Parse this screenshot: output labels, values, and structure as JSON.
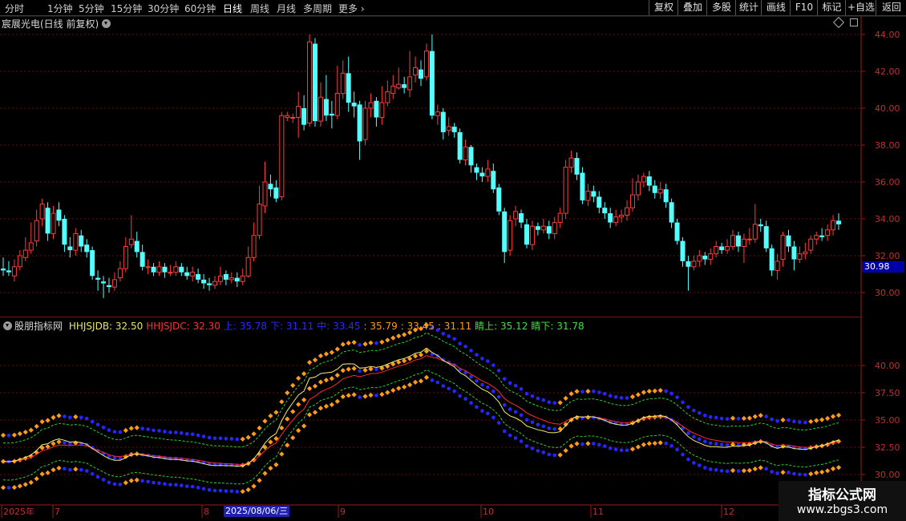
{
  "toolbar": {
    "periods": [
      "分时",
      "1分钟",
      "5分钟",
      "15分钟",
      "30分钟",
      "60分钟",
      "日线",
      "周线",
      "月线",
      "多周期",
      "更多"
    ],
    "active_period": "日线",
    "right_buttons": [
      "复权",
      "叠加",
      "多股",
      "统计",
      "画线",
      "F10",
      "标记",
      "+自选",
      "返回"
    ]
  },
  "main_chart": {
    "title": "宸展光电(日线 前复权)",
    "current_price": "30.98",
    "y_ticks": [
      "44.00",
      "42.00",
      "40.00",
      "38.00",
      "36.00",
      "34.00",
      "32.00",
      "30.00"
    ],
    "candles": [
      [
        31.3,
        31.2,
        31.9,
        30.9
      ],
      [
        31.2,
        31.1,
        31.7,
        30.9
      ],
      [
        30.9,
        31.4,
        31.8,
        30.6
      ],
      [
        31.4,
        32.0,
        32.3,
        31.2
      ],
      [
        31.9,
        32.3,
        33.0,
        31.7
      ],
      [
        32.3,
        32.7,
        33.8,
        32.1
      ],
      [
        32.8,
        33.9,
        34.5,
        32.5
      ],
      [
        34.0,
        34.8,
        35.1,
        33.6
      ],
      [
        34.6,
        33.2,
        34.9,
        32.8
      ],
      [
        33.2,
        34.3,
        34.7,
        32.9
      ],
      [
        34.5,
        33.9,
        34.9,
        33.6
      ],
      [
        34.0,
        32.6,
        34.2,
        32.2
      ],
      [
        32.5,
        32.3,
        33.0,
        31.9
      ],
      [
        32.3,
        33.2,
        33.5,
        32.0
      ],
      [
        33.1,
        32.5,
        33.4,
        32.2
      ],
      [
        32.6,
        32.2,
        32.9,
        31.9
      ],
      [
        32.3,
        30.9,
        32.5,
        30.7
      ],
      [
        30.8,
        30.7,
        31.2,
        30.1
      ],
      [
        30.6,
        30.5,
        30.9,
        29.7
      ],
      [
        30.4,
        30.3,
        30.8,
        30.0
      ],
      [
        30.3,
        30.7,
        31.1,
        30.1
      ],
      [
        30.8,
        31.3,
        31.7,
        30.6
      ],
      [
        31.3,
        32.5,
        33.0,
        31.1
      ],
      [
        32.6,
        32.9,
        34.2,
        32.4
      ],
      [
        32.8,
        32.2,
        33.3,
        31.9
      ],
      [
        32.2,
        31.4,
        32.6,
        31.2
      ],
      [
        31.4,
        31.4,
        31.8,
        31.0
      ],
      [
        31.4,
        31.1,
        31.6,
        30.9
      ],
      [
        31.1,
        31.4,
        31.7,
        30.9
      ],
      [
        31.4,
        31.1,
        31.6,
        30.8
      ],
      [
        31.1,
        31.1,
        31.5,
        30.9
      ],
      [
        31.1,
        31.4,
        31.7,
        30.9
      ],
      [
        31.4,
        31.1,
        31.6,
        30.9
      ],
      [
        31.1,
        30.9,
        31.4,
        30.7
      ],
      [
        30.9,
        31.1,
        31.4,
        30.6
      ],
      [
        31.0,
        30.7,
        31.3,
        30.5
      ],
      [
        30.7,
        30.5,
        31.0,
        30.2
      ],
      [
        30.5,
        30.4,
        30.8,
        30.1
      ],
      [
        30.4,
        30.6,
        30.9,
        30.2
      ],
      [
        30.6,
        30.9,
        31.4,
        30.4
      ],
      [
        31.0,
        30.7,
        31.2,
        30.4
      ],
      [
        30.7,
        30.8,
        31.1,
        30.5
      ],
      [
        30.8,
        30.6,
        31.1,
        30.3
      ],
      [
        30.6,
        30.9,
        31.3,
        30.4
      ],
      [
        30.9,
        31.9,
        32.5,
        30.8
      ],
      [
        31.9,
        33.1,
        33.8,
        31.7
      ],
      [
        33.1,
        34.8,
        35.8,
        32.9
      ],
      [
        34.7,
        36.0,
        37.1,
        34.3
      ],
      [
        35.9,
        35.6,
        36.4,
        35.2
      ],
      [
        35.7,
        35.1,
        36.1,
        34.9
      ],
      [
        35.2,
        39.6,
        39.8,
        35.0
      ],
      [
        39.5,
        39.6,
        39.8,
        39.3
      ],
      [
        39.5,
        39.5,
        39.7,
        39.2
      ],
      [
        39.5,
        40.1,
        40.9,
        38.4
      ],
      [
        40.0,
        39.1,
        40.7,
        38.8
      ],
      [
        39.2,
        43.6,
        44.0,
        39.0
      ],
      [
        43.5,
        39.3,
        43.8,
        39.0
      ],
      [
        39.3,
        40.6,
        41.4,
        39.0
      ],
      [
        40.5,
        39.6,
        41.8,
        39.3
      ],
      [
        39.7,
        39.6,
        40.4,
        38.9
      ],
      [
        39.6,
        40.8,
        42.3,
        39.4
      ],
      [
        40.8,
        41.9,
        42.6,
        40.5
      ],
      [
        41.9,
        40.3,
        42.8,
        39.8
      ],
      [
        40.3,
        40.1,
        40.9,
        39.5
      ],
      [
        40.2,
        38.2,
        40.4,
        37.2
      ],
      [
        38.3,
        40.0,
        40.4,
        38.0
      ],
      [
        40.0,
        40.3,
        40.8,
        39.5
      ],
      [
        40.4,
        39.5,
        40.6,
        39.0
      ],
      [
        39.5,
        40.3,
        41.2,
        39.1
      ],
      [
        40.3,
        40.9,
        41.5,
        40.1
      ],
      [
        40.8,
        41.2,
        41.8,
        40.5
      ],
      [
        41.1,
        41.3,
        42.2,
        41.0
      ],
      [
        41.3,
        41.1,
        41.7,
        40.8
      ],
      [
        41.0,
        41.7,
        43.1,
        40.6
      ],
      [
        41.8,
        42.2,
        42.8,
        41.4
      ],
      [
        42.1,
        41.6,
        42.6,
        41.2
      ],
      [
        41.7,
        43.1,
        43.5,
        41.5
      ],
      [
        43.1,
        39.6,
        44.0,
        39.4
      ],
      [
        39.6,
        39.8,
        40.2,
        39.1
      ],
      [
        39.8,
        38.7,
        40.0,
        38.3
      ],
      [
        38.8,
        39.0,
        39.5,
        38.5
      ],
      [
        39.0,
        38.7,
        39.2,
        38.4
      ],
      [
        38.7,
        37.2,
        38.9,
        37.0
      ],
      [
        37.2,
        37.9,
        38.3,
        36.9
      ],
      [
        37.9,
        36.9,
        38.0,
        36.5
      ],
      [
        36.8,
        36.5,
        37.0,
        36.1
      ],
      [
        36.5,
        36.3,
        36.8,
        36.0
      ],
      [
        36.3,
        36.7,
        37.2,
        36.0
      ],
      [
        36.6,
        35.6,
        37.0,
        35.4
      ],
      [
        35.7,
        34.4,
        35.9,
        34.2
      ],
      [
        34.4,
        32.2,
        34.6,
        31.6
      ],
      [
        32.3,
        33.9,
        34.2,
        32.0
      ],
      [
        34.0,
        34.4,
        34.7,
        33.6
      ],
      [
        34.3,
        33.8,
        34.5,
        33.5
      ],
      [
        33.7,
        32.6,
        34.0,
        32.4
      ],
      [
        32.6,
        33.6,
        33.9,
        32.3
      ],
      [
        33.6,
        33.4,
        33.8,
        33.1
      ],
      [
        33.4,
        33.6,
        34.0,
        33.2
      ],
      [
        33.6,
        33.2,
        33.9,
        32.9
      ],
      [
        33.2,
        33.8,
        34.1,
        32.9
      ],
      [
        33.8,
        34.3,
        34.6,
        33.5
      ],
      [
        34.3,
        36.8,
        37.2,
        34.0
      ],
      [
        36.8,
        37.3,
        37.7,
        36.5
      ],
      [
        37.3,
        36.4,
        37.6,
        36.1
      ],
      [
        36.5,
        35.0,
        36.8,
        34.8
      ],
      [
        35.0,
        35.5,
        35.9,
        34.7
      ],
      [
        35.5,
        35.2,
        35.8,
        34.9
      ],
      [
        35.2,
        34.6,
        35.5,
        34.3
      ],
      [
        34.6,
        34.3,
        34.9,
        34.0
      ],
      [
        34.3,
        33.8,
        34.6,
        33.5
      ],
      [
        33.8,
        34.1,
        34.5,
        33.6
      ],
      [
        34.1,
        34.2,
        34.5,
        33.8
      ],
      [
        34.2,
        34.6,
        35.0,
        33.9
      ],
      [
        34.6,
        35.3,
        36.2,
        34.4
      ],
      [
        35.3,
        36.0,
        36.4,
        35.0
      ],
      [
        36.0,
        36.3,
        36.5,
        35.7
      ],
      [
        36.3,
        35.8,
        36.6,
        35.5
      ],
      [
        35.8,
        35.4,
        36.1,
        35.1
      ],
      [
        35.4,
        35.6,
        36.0,
        35.1
      ],
      [
        35.6,
        34.9,
        35.9,
        34.6
      ],
      [
        34.9,
        33.8,
        35.1,
        33.5
      ],
      [
        33.8,
        32.8,
        34.0,
        32.6
      ],
      [
        32.8,
        31.7,
        33.0,
        31.4
      ],
      [
        31.7,
        31.4,
        32.0,
        30.1
      ],
      [
        31.4,
        31.7,
        32.0,
        31.2
      ],
      [
        31.7,
        32.0,
        32.3,
        31.4
      ],
      [
        32.0,
        31.8,
        32.2,
        31.5
      ],
      [
        31.8,
        32.1,
        32.4,
        31.5
      ],
      [
        32.1,
        32.5,
        32.8,
        31.9
      ],
      [
        32.5,
        32.3,
        32.7,
        32.1
      ],
      [
        32.3,
        32.5,
        32.9,
        32.1
      ],
      [
        32.5,
        33.1,
        33.4,
        32.3
      ],
      [
        33.1,
        32.5,
        33.3,
        32.2
      ],
      [
        32.5,
        32.9,
        33.2,
        31.6
      ],
      [
        32.9,
        32.9,
        33.5,
        32.6
      ],
      [
        32.9,
        33.7,
        34.8,
        32.7
      ],
      [
        33.7,
        33.6,
        34.0,
        33.3
      ],
      [
        33.6,
        32.4,
        33.9,
        32.2
      ],
      [
        32.4,
        31.2,
        32.6,
        30.9
      ],
      [
        31.2,
        31.7,
        32.1,
        30.7
      ],
      [
        31.8,
        33.1,
        33.3,
        31.4
      ],
      [
        33.1,
        32.5,
        33.4,
        32.2
      ],
      [
        32.5,
        31.8,
        32.8,
        31.2
      ],
      [
        31.8,
        32.1,
        32.5,
        31.6
      ],
      [
        32.1,
        32.2,
        32.7,
        31.8
      ],
      [
        32.3,
        32.9,
        33.1,
        32.1
      ],
      [
        32.9,
        33.1,
        33.3,
        32.6
      ],
      [
        33.1,
        33.0,
        33.5,
        32.8
      ],
      [
        33.1,
        33.4,
        33.7,
        32.8
      ],
      [
        33.4,
        33.9,
        34.2,
        33.1
      ],
      [
        33.9,
        33.7,
        34.3,
        33.4
      ]
    ]
  },
  "indicator": {
    "name": "股朋指标网",
    "labels": [
      {
        "text": "HHJSJDB: 32.50",
        "color": "#e8e860"
      },
      {
        "text": "HHJSJDC: 32.30",
        "color": "#ff3030"
      },
      {
        "text": "上: 35.78",
        "color": "#2a2aff"
      },
      {
        "text": "下: 31.11",
        "color": "#2a2aff"
      },
      {
        "text": "中: 33.45",
        "color": "#2a2aff"
      },
      {
        "text": ": 35.79",
        "color": "#ff9b1a"
      },
      {
        "text": ": 33.45",
        "color": "#ff9b1a"
      },
      {
        "text": ": 31.11",
        "color": "#ff9b1a"
      },
      {
        "text": "睛上: 35.12",
        "color": "#40e040"
      },
      {
        "text": "睛下: 31.78",
        "color": "#40e040"
      }
    ],
    "y_ticks": [
      "40.00",
      "37.50",
      "35.00",
      "32.50",
      "30.00"
    ]
  },
  "x_axis": {
    "labels": [
      "2025年",
      "7",
      "8",
      "9",
      "10",
      "11",
      "12"
    ],
    "selected_date": "2025/08/06/三"
  },
  "watermark": {
    "title": "指标公式网",
    "url": "www.zbgs3.com"
  },
  "colors": {
    "up": "#ff3c3c",
    "down": "#54ffff",
    "grid": "#7a1010"
  }
}
